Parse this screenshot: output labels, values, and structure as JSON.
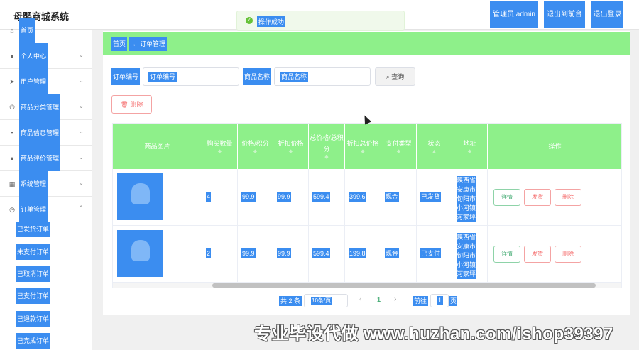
{
  "app": {
    "title": "母婴商城系统"
  },
  "toast": {
    "message": "操作成功"
  },
  "topbar": {
    "admin_label": "管理员 admin",
    "front_label": "退出到前台",
    "logout_label": "退出登录"
  },
  "sidebar": {
    "items": [
      {
        "label": "首页",
        "icon": "home-icon"
      },
      {
        "label": "个人中心",
        "icon": "user-icon"
      },
      {
        "label": "用户管理",
        "icon": "send-icon"
      },
      {
        "label": "商品分类管理",
        "icon": "power-icon"
      },
      {
        "label": "商品信息管理",
        "icon": "message-icon"
      },
      {
        "label": "商品评价管理",
        "icon": "user-icon"
      },
      {
        "label": "系统管理",
        "icon": "grid-icon"
      },
      {
        "label": "订单管理",
        "icon": "clock-icon"
      }
    ],
    "sub_items": [
      "已发货订单",
      "未支付订单",
      "已取消订单",
      "已支付订单",
      "已退款订单",
      "已完成订单"
    ]
  },
  "breadcrumb": {
    "home": "首页",
    "separator": "→",
    "current": "订单管理"
  },
  "filters": {
    "order_no_label": "订单编号",
    "order_no_placeholder": "订单编号",
    "product_name_label": "商品名称",
    "product_name_placeholder": "商品名称",
    "search_label": "查询",
    "delete_label": "删除"
  },
  "table": {
    "columns": [
      "商品图片",
      "购买数量",
      "价格/积分",
      "折扣价格",
      "总价格/总积分",
      "折扣总价格",
      "支付类型",
      "状态",
      "地址",
      "操作"
    ],
    "rows": [
      {
        "quantity": "4",
        "price": "99.9",
        "discount_price": "99.9",
        "total": "599.4",
        "discount_total": "399.6",
        "pay_type": "现金",
        "status": "已发货",
        "address": "陕西省安康市旬阳市小河镇河家坪"
      },
      {
        "quantity": "2",
        "price": "99.9",
        "discount_price": "99.9",
        "total": "599.4",
        "discount_total": "199.8",
        "pay_type": "现金",
        "status": "已支付",
        "address": "陕西省安康市旬阳市小河镇河家坪"
      }
    ],
    "actions": {
      "view": "详情",
      "ship": "发货",
      "delete": "删除"
    }
  },
  "pagination": {
    "total": "共 2 条",
    "page_size": "10条/页",
    "current_page": "1",
    "goto_label": "前往",
    "goto_value": "1",
    "page_unit": "页"
  },
  "watermark": {
    "text": "专业毕设代做 www.huzhan.com/ishop39397"
  }
}
